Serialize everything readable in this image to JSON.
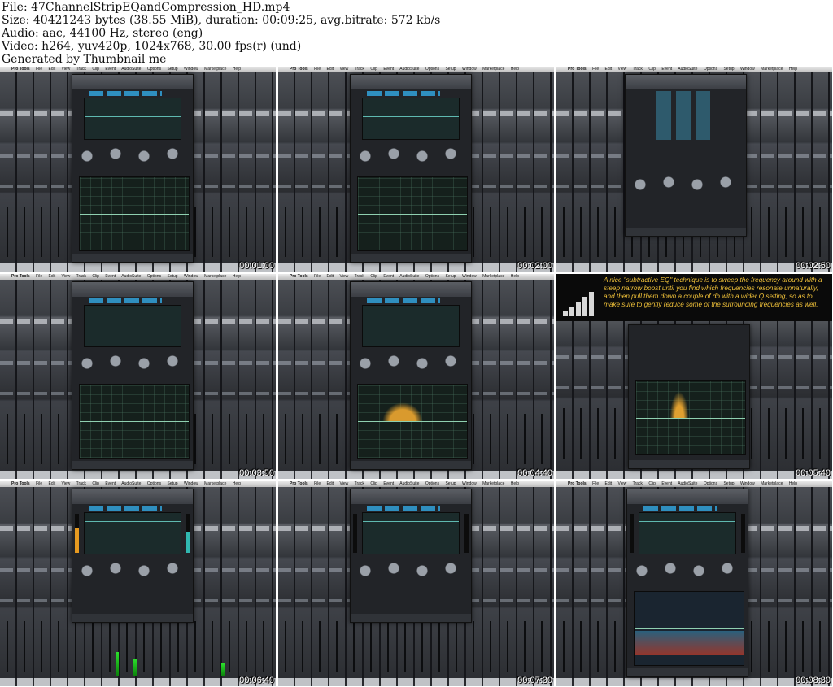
{
  "header": {
    "file": "File: 47ChannelStripEQandCompression_HD.mp4",
    "size": "Size: 40421243 bytes (38.55 MiB), duration: 00:09:25, avg.bitrate: 572 kb/s",
    "audio": "Audio: aac, 44100 Hz, stereo (eng)",
    "video": "Video: h264, yuv420p, 1024x768, 30.00 fps(r) (und)",
    "generated": "Generated by Thumbnail me"
  },
  "menubar": {
    "app": "Pro Tools",
    "items": [
      "File",
      "Edit",
      "View",
      "Track",
      "Clip",
      "Event",
      "AudioSuite",
      "Options",
      "Setup",
      "Window",
      "Marketplace",
      "Help"
    ]
  },
  "tip": {
    "text": "A nice \"subtractive EQ\" technique is to sweep the frequency around with a steep narrow boost until you find which frequencies resonate unnaturally, and then pull them down a couple of db with a wider Q setting, so as to make sure to gently reduce some of the surrounding frequencies as well."
  },
  "tiles": [
    {
      "timestamp": "00:01:00"
    },
    {
      "timestamp": "00:02:00"
    },
    {
      "timestamp": "00:02:50"
    },
    {
      "timestamp": "00:03:50"
    },
    {
      "timestamp": "00:04:40"
    },
    {
      "timestamp": "00:05:40"
    },
    {
      "timestamp": "00:06:40"
    },
    {
      "timestamp": "00:07:30"
    },
    {
      "timestamp": "00:08:30"
    }
  ]
}
